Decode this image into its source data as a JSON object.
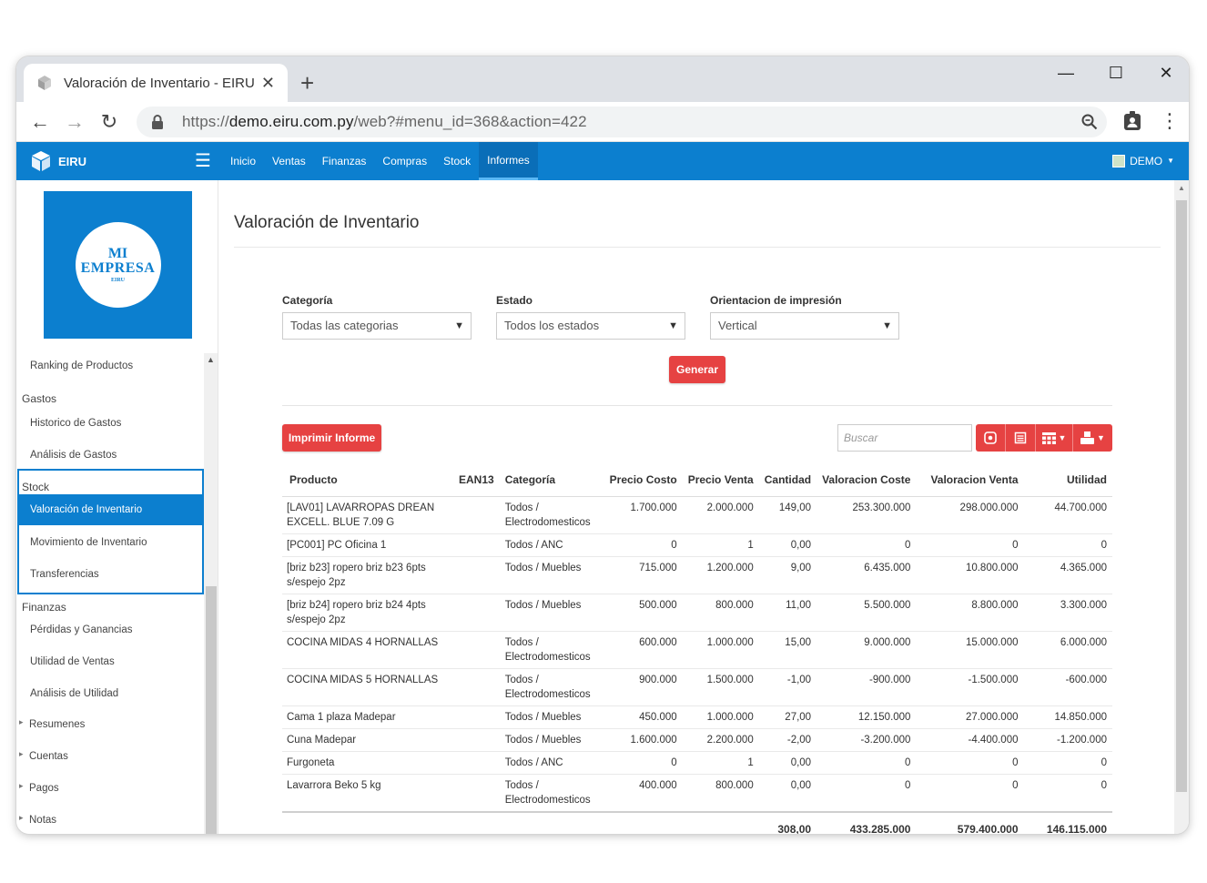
{
  "browser": {
    "tab_title": "Valoración de Inventario - EIRU",
    "url_prefix": "https://",
    "url_host": "demo.eiru.com.py",
    "url_path": "/web?#menu_id=368&action=422"
  },
  "navbar": {
    "brand": "EIRU",
    "menu": [
      "Inicio",
      "Ventas",
      "Finanzas",
      "Compras",
      "Stock",
      "Informes"
    ],
    "active_menu": "Informes",
    "user": "DEMO"
  },
  "sidebar": {
    "logo": {
      "line1": "MI",
      "line2": "EMPRESA",
      "line3": "EIRU"
    },
    "ranking": "Ranking de Productos",
    "gastos_head": "Gastos",
    "gastos_items": [
      "Historico de Gastos",
      "Análisis de Gastos"
    ],
    "stock_head": "Stock",
    "stock_items": [
      "Valoración de Inventario",
      "Movimiento de Inventario",
      "Transferencias"
    ],
    "finanzas_head": "Finanzas",
    "finanzas_items": [
      "Pérdidas y Ganancias",
      "Utilidad de Ventas",
      "Análisis de Utilidad"
    ],
    "tree_items": [
      "Resumenes",
      "Cuentas",
      "Pagos",
      "Notas"
    ]
  },
  "page": {
    "title": "Valoración de Inventario",
    "filters": {
      "categoria_label": "Categoría",
      "categoria_value": "Todas las categorias",
      "estado_label": "Estado",
      "estado_value": "Todos los estados",
      "orientacion_label": "Orientacion de impresión",
      "orientacion_value": "Vertical"
    },
    "generar_label": "Generar",
    "imprimir_label": "Imprimir Informe",
    "search_placeholder": "Buscar"
  },
  "table": {
    "headers": [
      "Producto",
      "EAN13",
      "Categoría",
      "Precio Costo",
      "Precio Venta",
      "Cantidad",
      "Valoracion Coste",
      "Valoracion Venta",
      "Utilidad"
    ],
    "rows": [
      [
        "[LAV01] LAVARROPAS DREAN EXCELL. BLUE 7.09 G",
        "",
        "Todos / Electrodomesticos",
        "1.700.000",
        "2.000.000",
        "149,00",
        "253.300.000",
        "298.000.000",
        "44.700.000"
      ],
      [
        "[PC001] PC Oficina 1",
        "",
        "Todos / ANC",
        "0",
        "1",
        "0,00",
        "0",
        "0",
        "0"
      ],
      [
        "[briz b23] ropero briz b23 6pts s/espejo 2pz",
        "",
        "Todos / Muebles",
        "715.000",
        "1.200.000",
        "9,00",
        "6.435.000",
        "10.800.000",
        "4.365.000"
      ],
      [
        "[briz b24] ropero briz b24 4pts s/espejo 2pz",
        "",
        "Todos / Muebles",
        "500.000",
        "800.000",
        "11,00",
        "5.500.000",
        "8.800.000",
        "3.300.000"
      ],
      [
        "COCINA MIDAS 4 HORNALLAS",
        "",
        "Todos / Electrodomesticos",
        "600.000",
        "1.000.000",
        "15,00",
        "9.000.000",
        "15.000.000",
        "6.000.000"
      ],
      [
        "COCINA MIDAS 5 HORNALLAS",
        "",
        "Todos / Electrodomesticos",
        "900.000",
        "1.500.000",
        "-1,00",
        "-900.000",
        "-1.500.000",
        "-600.000"
      ],
      [
        "Cama 1 plaza Madepar",
        "",
        "Todos / Muebles",
        "450.000",
        "1.000.000",
        "27,00",
        "12.150.000",
        "27.000.000",
        "14.850.000"
      ],
      [
        "Cuna Madepar",
        "",
        "Todos / Muebles",
        "1.600.000",
        "2.200.000",
        "-2,00",
        "-3.200.000",
        "-4.400.000",
        "-1.200.000"
      ],
      [
        "Furgoneta",
        "",
        "Todos / ANC",
        "0",
        "1",
        "0,00",
        "0",
        "0",
        "0"
      ],
      [
        "Lavarrora Beko 5 kg",
        "",
        "Todos / Electrodomesticos",
        "400.000",
        "800.000",
        "0,00",
        "0",
        "0",
        "0"
      ]
    ],
    "totals": {
      "cantidad": "308,00",
      "valoracion_coste": "433.285.000",
      "valoracion_venta": "579.400.000",
      "utilidad": "146.115.000"
    }
  }
}
